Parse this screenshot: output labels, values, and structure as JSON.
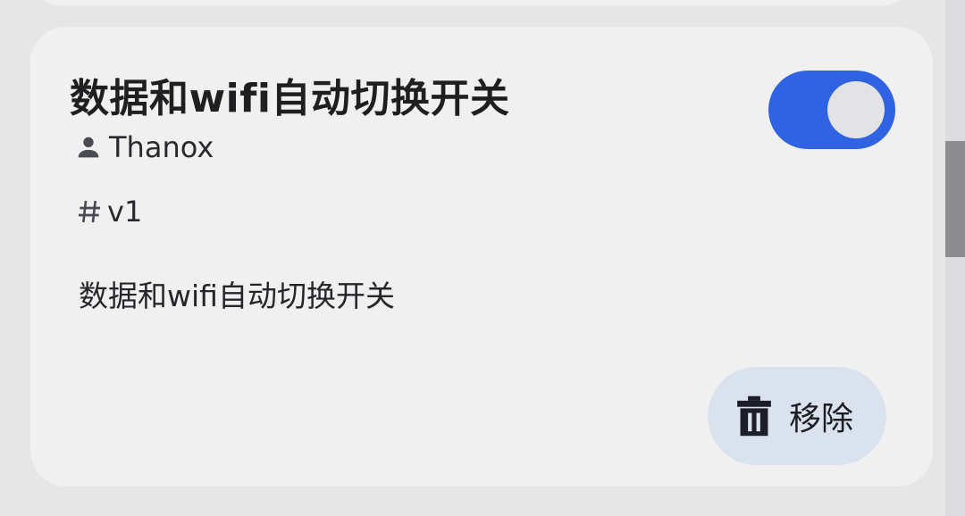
{
  "card": {
    "title": "数据和wifi自动切换开关",
    "author": "Thanox",
    "version": "v1",
    "description": "数据和wifi自动切换开关",
    "enabled": true,
    "remove_label": "移除"
  },
  "icons": {
    "author": "person-icon",
    "version": "hash-icon",
    "remove": "trash-icon"
  },
  "colors": {
    "accent": "#2f63e3",
    "remove_button_bg": "#dae2ee",
    "card_bg": "#f0f0f1"
  }
}
